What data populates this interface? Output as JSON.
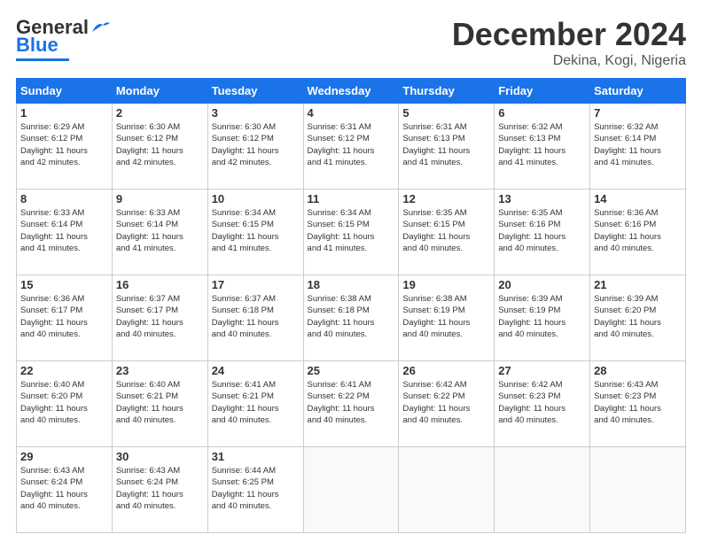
{
  "header": {
    "logo_main": "General",
    "logo_sub": "Blue",
    "month": "December 2024",
    "location": "Dekina, Kogi, Nigeria"
  },
  "days_of_week": [
    "Sunday",
    "Monday",
    "Tuesday",
    "Wednesday",
    "Thursday",
    "Friday",
    "Saturday"
  ],
  "weeks": [
    [
      {
        "day": "1",
        "sunrise": "6:29 AM",
        "sunset": "6:12 PM",
        "daylight": "11 hours and 42 minutes."
      },
      {
        "day": "2",
        "sunrise": "6:30 AM",
        "sunset": "6:12 PM",
        "daylight": "11 hours and 42 minutes."
      },
      {
        "day": "3",
        "sunrise": "6:30 AM",
        "sunset": "6:12 PM",
        "daylight": "11 hours and 42 minutes."
      },
      {
        "day": "4",
        "sunrise": "6:31 AM",
        "sunset": "6:12 PM",
        "daylight": "11 hours and 41 minutes."
      },
      {
        "day": "5",
        "sunrise": "6:31 AM",
        "sunset": "6:13 PM",
        "daylight": "11 hours and 41 minutes."
      },
      {
        "day": "6",
        "sunrise": "6:32 AM",
        "sunset": "6:13 PM",
        "daylight": "11 hours and 41 minutes."
      },
      {
        "day": "7",
        "sunrise": "6:32 AM",
        "sunset": "6:14 PM",
        "daylight": "11 hours and 41 minutes."
      }
    ],
    [
      {
        "day": "8",
        "sunrise": "6:33 AM",
        "sunset": "6:14 PM",
        "daylight": "11 hours and 41 minutes."
      },
      {
        "day": "9",
        "sunrise": "6:33 AM",
        "sunset": "6:14 PM",
        "daylight": "11 hours and 41 minutes."
      },
      {
        "day": "10",
        "sunrise": "6:34 AM",
        "sunset": "6:15 PM",
        "daylight": "11 hours and 41 minutes."
      },
      {
        "day": "11",
        "sunrise": "6:34 AM",
        "sunset": "6:15 PM",
        "daylight": "11 hours and 41 minutes."
      },
      {
        "day": "12",
        "sunrise": "6:35 AM",
        "sunset": "6:15 PM",
        "daylight": "11 hours and 40 minutes."
      },
      {
        "day": "13",
        "sunrise": "6:35 AM",
        "sunset": "6:16 PM",
        "daylight": "11 hours and 40 minutes."
      },
      {
        "day": "14",
        "sunrise": "6:36 AM",
        "sunset": "6:16 PM",
        "daylight": "11 hours and 40 minutes."
      }
    ],
    [
      {
        "day": "15",
        "sunrise": "6:36 AM",
        "sunset": "6:17 PM",
        "daylight": "11 hours and 40 minutes."
      },
      {
        "day": "16",
        "sunrise": "6:37 AM",
        "sunset": "6:17 PM",
        "daylight": "11 hours and 40 minutes."
      },
      {
        "day": "17",
        "sunrise": "6:37 AM",
        "sunset": "6:18 PM",
        "daylight": "11 hours and 40 minutes."
      },
      {
        "day": "18",
        "sunrise": "6:38 AM",
        "sunset": "6:18 PM",
        "daylight": "11 hours and 40 minutes."
      },
      {
        "day": "19",
        "sunrise": "6:38 AM",
        "sunset": "6:19 PM",
        "daylight": "11 hours and 40 minutes."
      },
      {
        "day": "20",
        "sunrise": "6:39 AM",
        "sunset": "6:19 PM",
        "daylight": "11 hours and 40 minutes."
      },
      {
        "day": "21",
        "sunrise": "6:39 AM",
        "sunset": "6:20 PM",
        "daylight": "11 hours and 40 minutes."
      }
    ],
    [
      {
        "day": "22",
        "sunrise": "6:40 AM",
        "sunset": "6:20 PM",
        "daylight": "11 hours and 40 minutes."
      },
      {
        "day": "23",
        "sunrise": "6:40 AM",
        "sunset": "6:21 PM",
        "daylight": "11 hours and 40 minutes."
      },
      {
        "day": "24",
        "sunrise": "6:41 AM",
        "sunset": "6:21 PM",
        "daylight": "11 hours and 40 minutes."
      },
      {
        "day": "25",
        "sunrise": "6:41 AM",
        "sunset": "6:22 PM",
        "daylight": "11 hours and 40 minutes."
      },
      {
        "day": "26",
        "sunrise": "6:42 AM",
        "sunset": "6:22 PM",
        "daylight": "11 hours and 40 minutes."
      },
      {
        "day": "27",
        "sunrise": "6:42 AM",
        "sunset": "6:23 PM",
        "daylight": "11 hours and 40 minutes."
      },
      {
        "day": "28",
        "sunrise": "6:43 AM",
        "sunset": "6:23 PM",
        "daylight": "11 hours and 40 minutes."
      }
    ],
    [
      {
        "day": "29",
        "sunrise": "6:43 AM",
        "sunset": "6:24 PM",
        "daylight": "11 hours and 40 minutes."
      },
      {
        "day": "30",
        "sunrise": "6:43 AM",
        "sunset": "6:24 PM",
        "daylight": "11 hours and 40 minutes."
      },
      {
        "day": "31",
        "sunrise": "6:44 AM",
        "sunset": "6:25 PM",
        "daylight": "11 hours and 40 minutes."
      },
      null,
      null,
      null,
      null
    ]
  ]
}
